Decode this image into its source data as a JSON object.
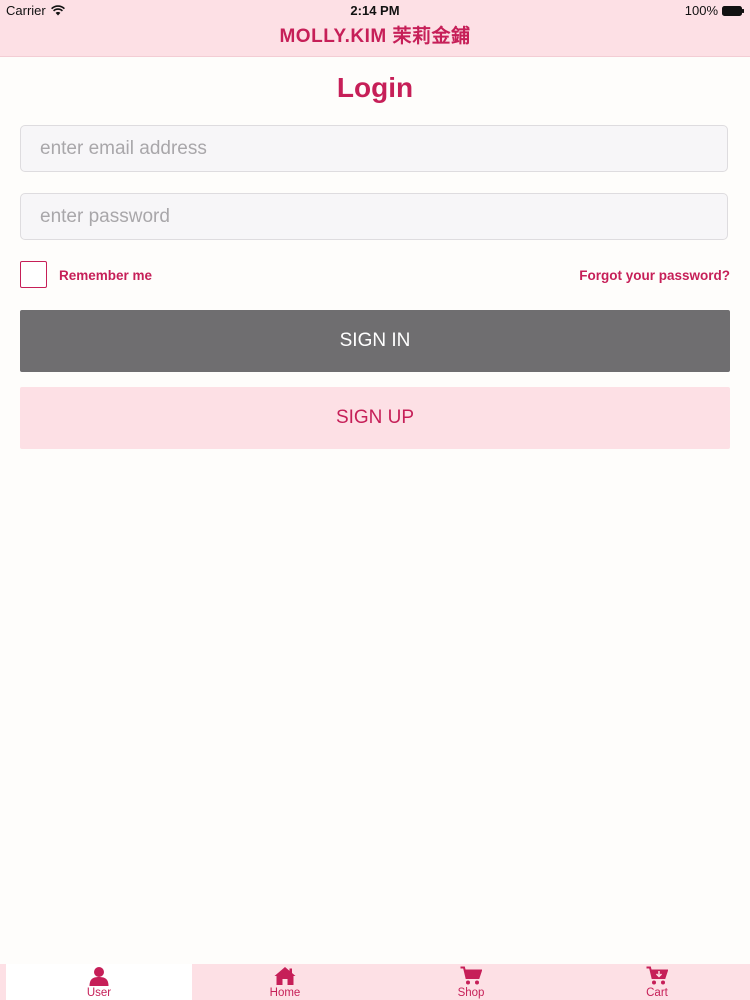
{
  "status_bar": {
    "carrier": "Carrier",
    "time": "2:14 PM",
    "battery": "100%"
  },
  "header": {
    "title": "MOLLY.KIM 茉莉金鋪"
  },
  "login": {
    "title": "Login",
    "email_placeholder": "enter email address",
    "password_placeholder": "enter password",
    "remember_label": "Remember me",
    "remember_checked": false,
    "forgot_label": "Forgot your password?",
    "sign_in_label": "SIGN IN",
    "sign_up_label": "SIGN UP"
  },
  "tabs": [
    {
      "label": "User",
      "icon": "user-icon",
      "active": true
    },
    {
      "label": "Home",
      "icon": "home-icon",
      "active": false
    },
    {
      "label": "Shop",
      "icon": "shopping-cart-icon",
      "active": false
    },
    {
      "label": "Cart",
      "icon": "cart-add-icon",
      "active": false
    }
  ],
  "colors": {
    "accent": "#c61f58",
    "bar_pink": "#fde0e5",
    "sign_in_gray": "#6f6e70"
  }
}
